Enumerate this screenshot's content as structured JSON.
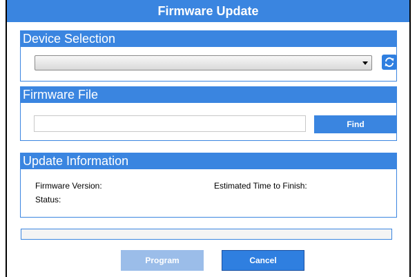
{
  "window": {
    "title": "Firmware Update"
  },
  "device_selection": {
    "header": "Device Selection",
    "selected_device": "",
    "refresh_icon": "refresh-icon"
  },
  "firmware_file": {
    "header": "Firmware File",
    "file_path": "",
    "find_label": "Find"
  },
  "update_information": {
    "header": "Update Information",
    "firmware_version_label": "Firmware Version:",
    "status_label": "Status:",
    "estimated_time_label": "Estimated Time to Finish:"
  },
  "progress": {
    "value_percent": 0
  },
  "buttons": {
    "program_label": "Program",
    "cancel_label": "Cancel"
  },
  "colors": {
    "accent": "#3a85e0",
    "disabled_button": "#9bbde9"
  }
}
